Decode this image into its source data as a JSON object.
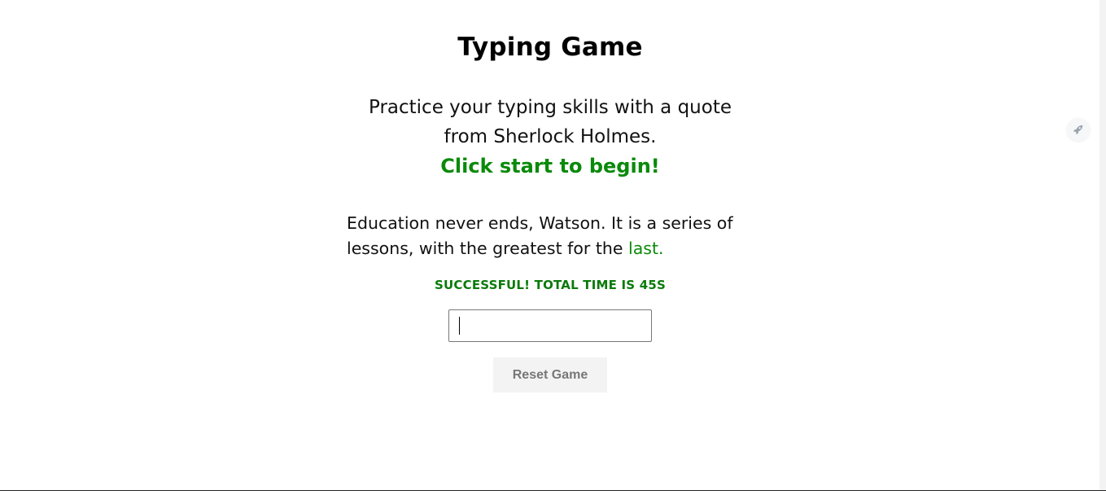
{
  "header": {
    "title": "Typing Game"
  },
  "intro": {
    "line": "Practice your typing skills with a quote from Sherlock Holmes.",
    "cta": "Click start to begin!"
  },
  "quote": {
    "text_before": "Education never ends, Watson. It is a series of lessons, with the greatest for the ",
    "current_word": "last."
  },
  "status": {
    "message": "SUCCESSFUL! TOTAL TIME IS 45S"
  },
  "input": {
    "value": "",
    "placeholder": ""
  },
  "controls": {
    "reset_label": "Reset Game"
  },
  "floating_action": {
    "icon": "rocket-icon"
  },
  "colors": {
    "accent_green": "#0a8a0a",
    "button_bg": "#f3f3f3",
    "button_text": "#777777"
  }
}
